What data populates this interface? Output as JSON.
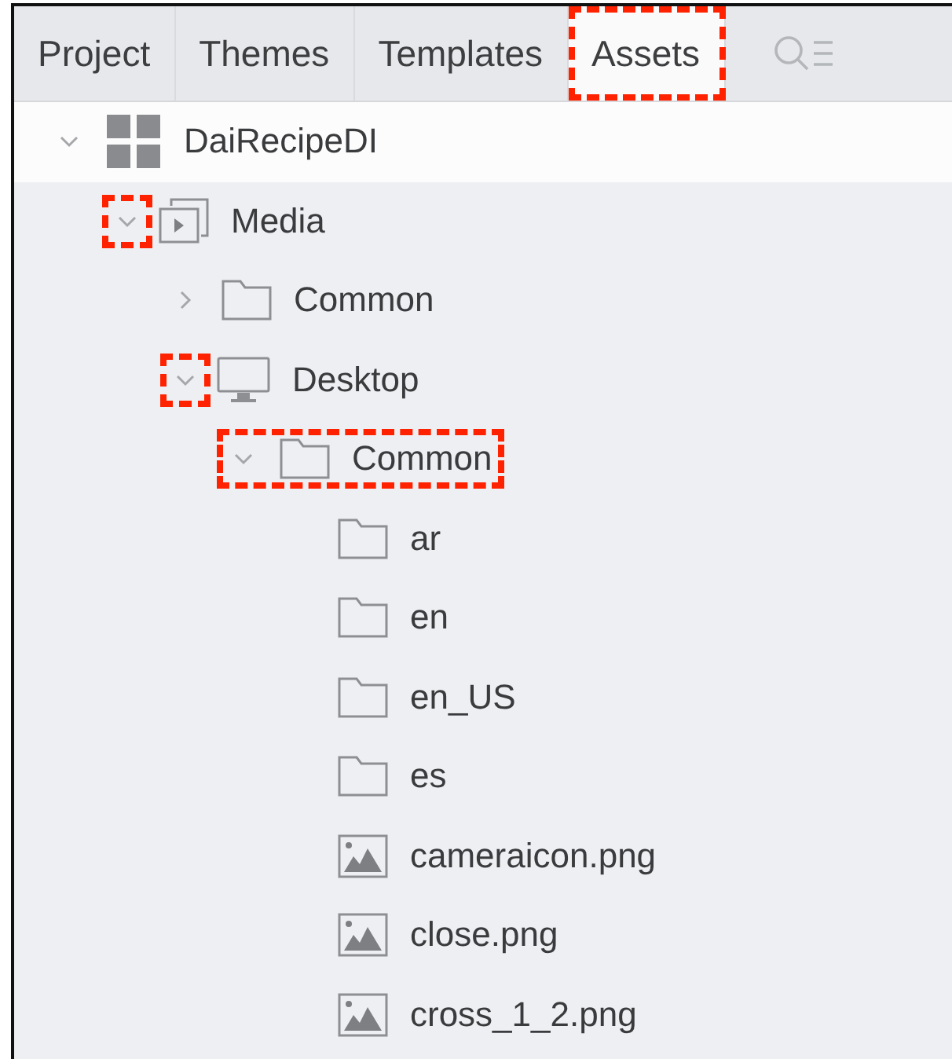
{
  "tabs": [
    {
      "label": "Project",
      "selected": false,
      "highlighted": false
    },
    {
      "label": "Themes",
      "selected": false,
      "highlighted": false
    },
    {
      "label": "Templates",
      "selected": false,
      "highlighted": false
    },
    {
      "label": "Assets",
      "selected": true,
      "highlighted": true
    }
  ],
  "tree": [
    {
      "label": "DaiRecipeDI",
      "kind": "grid",
      "expanded": true,
      "chevron_highlighted": false,
      "highlighted": false,
      "children": [
        {
          "label": "Media",
          "kind": "media",
          "expanded": true,
          "chevron_highlighted": true,
          "highlighted": false,
          "children": [
            {
              "label": "Common",
              "kind": "folder",
              "expanded": false,
              "chevron_highlighted": false,
              "highlighted": false
            },
            {
              "label": "Desktop",
              "kind": "desktop",
              "expanded": true,
              "chevron_highlighted": true,
              "highlighted": false,
              "children": [
                {
                  "label": "Common",
                  "kind": "folder",
                  "expanded": true,
                  "chevron_highlighted": false,
                  "highlighted": true,
                  "children": [
                    {
                      "label": "ar",
                      "kind": "folder"
                    },
                    {
                      "label": "en",
                      "kind": "folder"
                    },
                    {
                      "label": "en_US",
                      "kind": "folder"
                    },
                    {
                      "label": "es",
                      "kind": "folder"
                    },
                    {
                      "label": "cameraicon.png",
                      "kind": "image"
                    },
                    {
                      "label": "close.png",
                      "kind": "image"
                    },
                    {
                      "label": "cross_1_2.png",
                      "kind": "image"
                    }
                  ]
                }
              ]
            }
          ]
        }
      ]
    }
  ]
}
